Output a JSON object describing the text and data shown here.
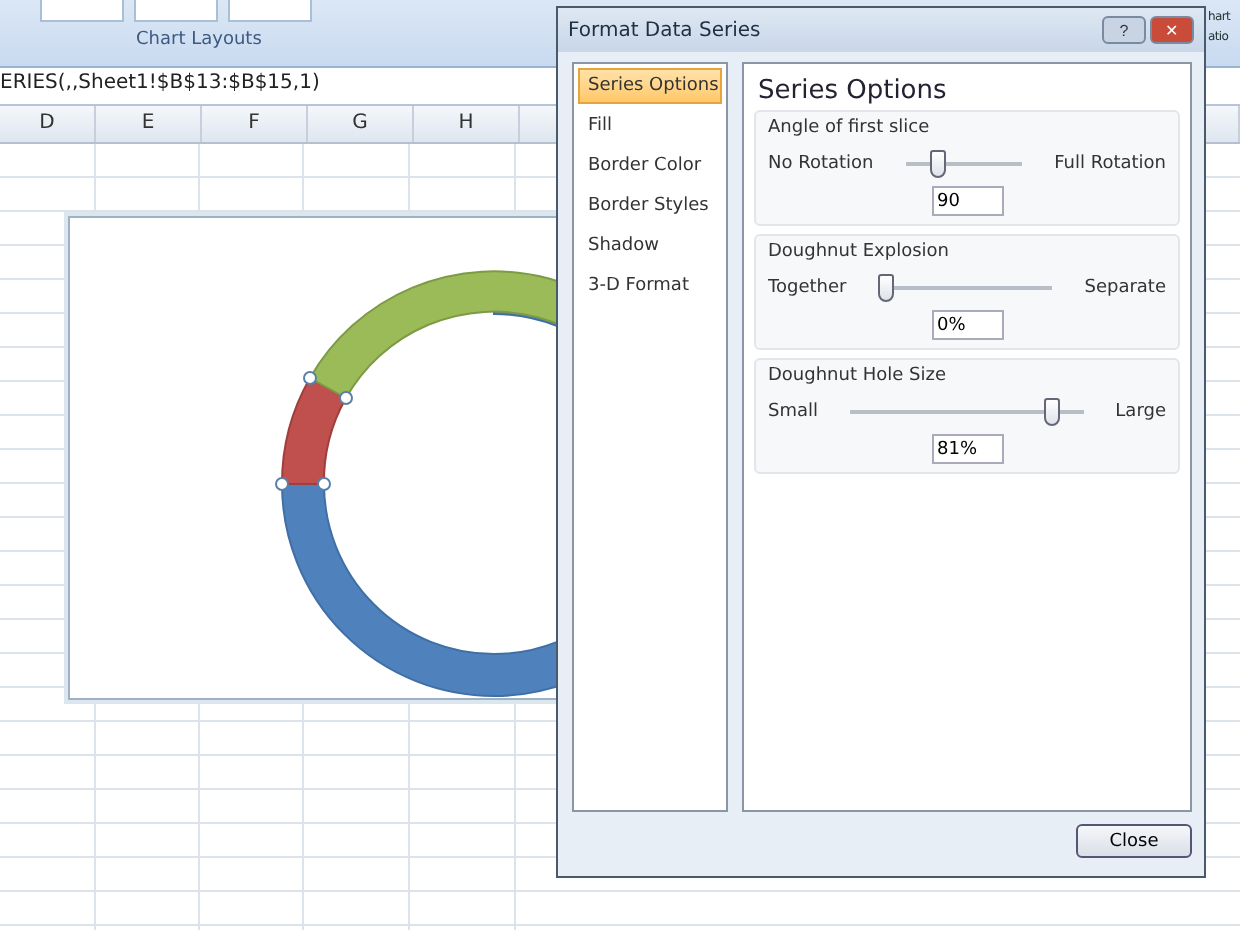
{
  "ribbon": {
    "group_label": "Chart Layouts",
    "edge_texts": [
      "hart",
      "atio"
    ]
  },
  "formula_bar": {
    "value": "ERIES(,,Sheet1!$B$13:$B$15,1)"
  },
  "columns": [
    "D",
    "E",
    "F",
    "G",
    "H"
  ],
  "dialog": {
    "title": "Format Data Series",
    "help": "?",
    "close_glyph": "✕",
    "nav": [
      {
        "label": "Series Options",
        "selected": true
      },
      {
        "label": "Fill",
        "selected": false
      },
      {
        "label": "Border Color",
        "selected": false
      },
      {
        "label": "Border Styles",
        "selected": false
      },
      {
        "label": "Shadow",
        "selected": false
      },
      {
        "label": "3-D Format",
        "selected": false
      }
    ],
    "heading": "Series Options",
    "groups": [
      {
        "title": "Angle of first slice",
        "min_label": "No Rotation",
        "max_label": "Full Rotation",
        "level": 0.25,
        "value": "90"
      },
      {
        "title": "Doughnut Explosion",
        "min_label": "Together",
        "max_label": "Separate",
        "level": 0,
        "value": "0%"
      },
      {
        "title": "Doughnut Hole Size",
        "min_label": "Small",
        "max_label": "Large",
        "level": 0.89,
        "value": "81%"
      }
    ],
    "close_button": "Close"
  }
}
